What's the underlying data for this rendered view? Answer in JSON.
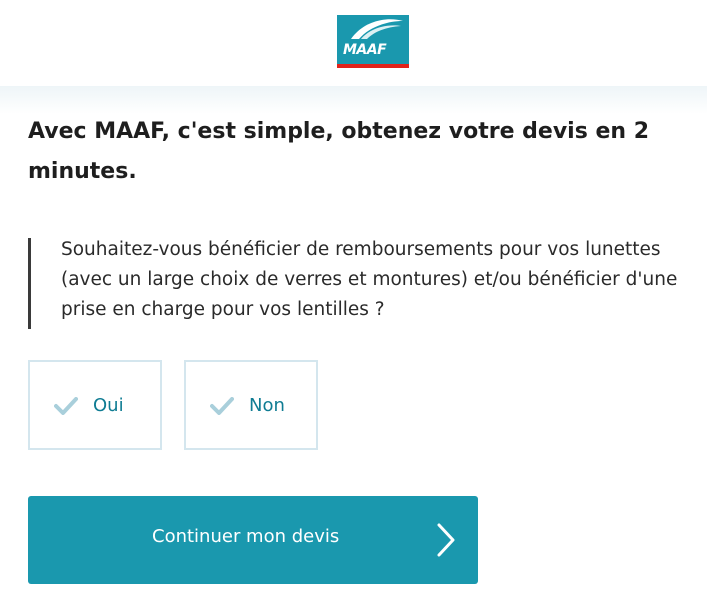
{
  "header": {
    "logo_text": "MAAF",
    "logo_color": "#1a98ae",
    "logo_stripe_color": "#e2231a"
  },
  "main": {
    "title": "Avec MAAF, c'est simple, obtenez votre devis en 2 minutes.",
    "question": "Souhaitez-vous bénéficier de remboursements pour vos lunettes (avec un large choix de verres et montures) et/ou bénéficier d'une prise en charge pour vos lentilles ?",
    "choices": [
      {
        "label": "Oui",
        "icon": "check-icon"
      },
      {
        "label": "Non",
        "icon": "check-icon"
      }
    ],
    "continue_label": "Continuer mon devis",
    "continue_icon": "chevron-right-icon"
  },
  "colors": {
    "accent": "#1a98ae",
    "choice_text": "#0f7c93",
    "choice_border": "#d4e6ee",
    "check": "#a9cfdb"
  }
}
